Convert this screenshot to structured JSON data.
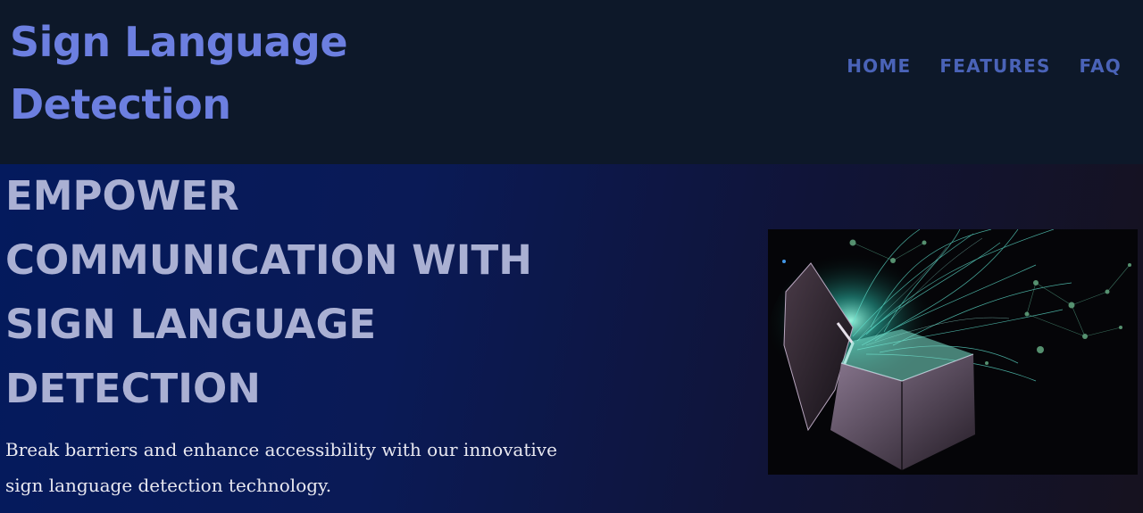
{
  "header": {
    "brand": "Sign Language Detection",
    "nav": {
      "home": "HOME",
      "features": "FEATURES",
      "faq": "FAQ"
    }
  },
  "hero": {
    "title": "EMPOWER COMMUNICATION WITH SIGN LANGUAGE DETECTION",
    "subtitle": "Break barriers and enhance accessibility with our innovative sign language detection technology."
  },
  "colors": {
    "brand": "#6c7fe0",
    "nav": "#4a63b8",
    "header_bg": "#0d1829",
    "hero_title": "#aab0d3",
    "hero_bg_start": "#041a5d",
    "hero_bg_end": "#16121f"
  }
}
